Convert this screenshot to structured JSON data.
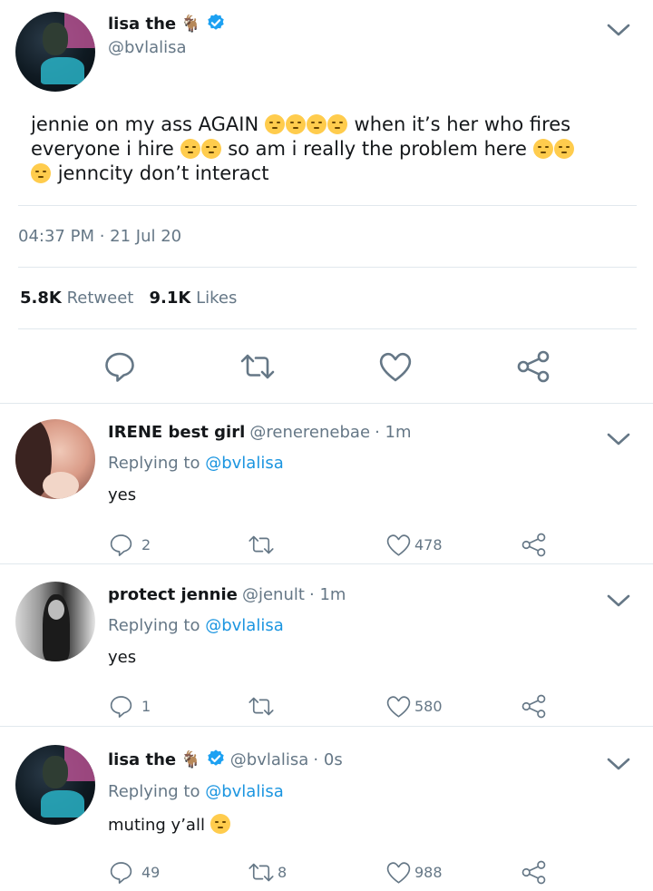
{
  "main_tweet": {
    "name": "lisa the",
    "name_emoji": "🐐",
    "handle": "@bvlalisa",
    "text_line1_a": "jennie on my ass AGAIN",
    "text_line1_b": "when it’s her who fires",
    "text_line2_a": "everyone i hire",
    "text_line2_b": "so am i really the problem here",
    "text_line3": "jenncity don’t interact",
    "timestamp": "04:37 PM · 21 Jul 20",
    "retweet_count": "5.8K",
    "retweet_label": "Retweet",
    "like_count": "9.1K",
    "like_label": "Likes"
  },
  "replies": [
    {
      "name": "IRENE best girl",
      "handle": "@renerenebae",
      "time": "· 1m",
      "replying_label": "Replying to",
      "replying_handle": "@bvlalisa",
      "text": "yes",
      "reply_count": "2",
      "retweet_count": "",
      "like_count": "478"
    },
    {
      "name": "protect jennie",
      "handle": "@jenult",
      "time": "· 1m",
      "replying_label": "Replying to",
      "replying_handle": "@bvlalisa",
      "text": "yes",
      "reply_count": "1",
      "retweet_count": "",
      "like_count": "580"
    },
    {
      "name": "lisa the",
      "name_emoji": "🐐",
      "handle": "@bvlalisa",
      "time": "· 0s",
      "replying_label": "Replying to",
      "replying_handle": "@bvlalisa",
      "text": "muting y’all",
      "reply_count": "49",
      "retweet_count": "8",
      "like_count": "988"
    }
  ],
  "icons": [
    "reply-icon",
    "retweet-icon",
    "like-icon",
    "share-icon",
    "verified-badge-icon",
    "chevron-down-icon"
  ],
  "colors": {
    "link": "#1b95e0",
    "muted": "#657786",
    "verified": "#1da1f2"
  }
}
